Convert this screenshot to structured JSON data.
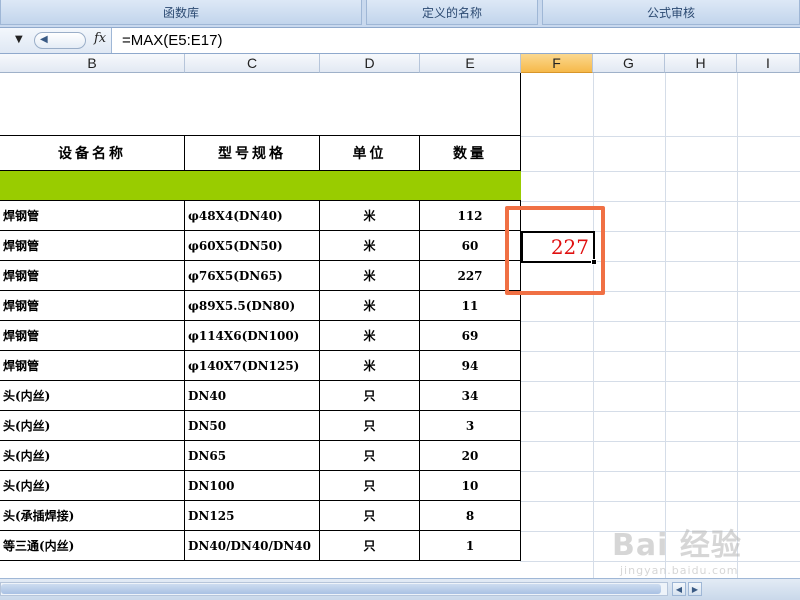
{
  "ribbon": {
    "groups": [
      "函数库",
      "定义的名称",
      "公式审核"
    ]
  },
  "formula_bar": {
    "fx_symbol": "fx",
    "formula": "=MAX(E5:E17)"
  },
  "columns": [
    "B",
    "C",
    "D",
    "E",
    "F",
    "G",
    "H",
    "I"
  ],
  "selected_column": "F",
  "table": {
    "headers": [
      "设备名称",
      "型号规格",
      "单位",
      "数量"
    ],
    "rows": [
      {
        "name": "焊钢管",
        "spec": "φ48X4(DN40)",
        "unit": "米",
        "qty": "112"
      },
      {
        "name": "焊钢管",
        "spec": "φ60X5(DN50)",
        "unit": "米",
        "qty": "60"
      },
      {
        "name": "焊钢管",
        "spec": "φ76X5(DN65)",
        "unit": "米",
        "qty": "227"
      },
      {
        "name": "焊钢管",
        "spec": "φ89X5.5(DN80)",
        "unit": "米",
        "qty": "11"
      },
      {
        "name": "焊钢管",
        "spec": "φ114X6(DN100)",
        "unit": "米",
        "qty": "69"
      },
      {
        "name": "焊钢管",
        "spec": "φ140X7(DN125)",
        "unit": "米",
        "qty": "94"
      },
      {
        "name": "头(内丝)",
        "spec": "DN40",
        "unit": "只",
        "qty": "34"
      },
      {
        "name": "头(内丝)",
        "spec": "DN50",
        "unit": "只",
        "qty": "3"
      },
      {
        "name": "头(内丝)",
        "spec": "DN65",
        "unit": "只",
        "qty": "20"
      },
      {
        "name": "头(内丝)",
        "spec": "DN100",
        "unit": "只",
        "qty": "10"
      },
      {
        "name": "头(承插焊接)",
        "spec": "DN125",
        "unit": "只",
        "qty": "8"
      },
      {
        "name": "等三通(内丝)",
        "spec": "DN40/DN40/DN40",
        "unit": "只",
        "qty": "1"
      }
    ]
  },
  "result_cell": {
    "value": "227",
    "color": "#e01010"
  },
  "highlight_color": "#f07044",
  "header_fill_color": "#99cc00",
  "watermark": {
    "line1": "Bai 经验",
    "line2": "jingyan.baidu.com"
  }
}
